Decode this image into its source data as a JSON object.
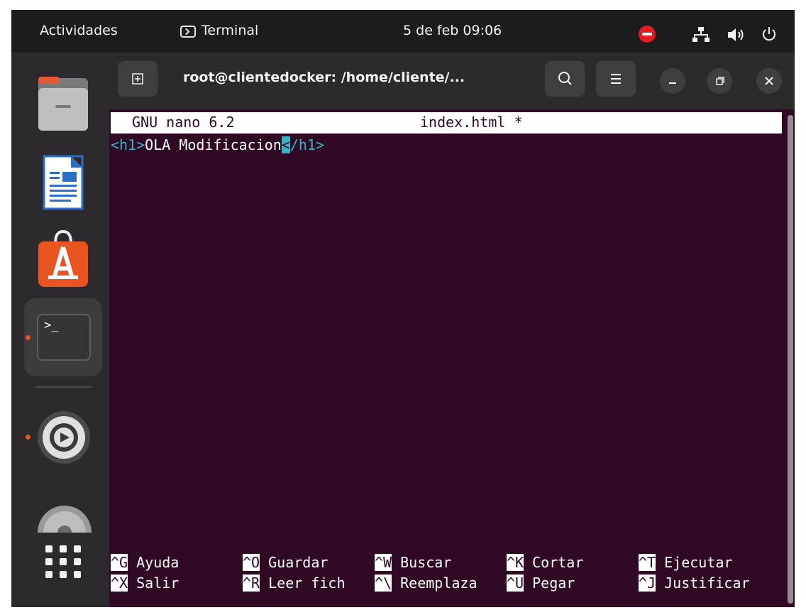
{
  "topbar": {
    "activities": "Actividades",
    "app_name": "Terminal",
    "clock": "5 de feb  09:06"
  },
  "window": {
    "title": "root@clientedocker: /home/cliente/..."
  },
  "nano": {
    "version": "GNU nano 6.2",
    "filename": "index.html *",
    "content": {
      "open_tag": "<h1>",
      "text": "OLA Modificacion",
      "cursor_char": "<",
      "close_rest": "/h1>"
    },
    "shortcuts": [
      {
        "key": "^G",
        "label": " Ayuda"
      },
      {
        "key": "^O",
        "label": " Guardar"
      },
      {
        "key": "^W",
        "label": " Buscar"
      },
      {
        "key": "^K",
        "label": " Cortar"
      },
      {
        "key": "^T",
        "label": " Ejecutar"
      },
      {
        "key": "^X",
        "label": " Salir"
      },
      {
        "key": "^R",
        "label": " Leer fich"
      },
      {
        "key": "^\\",
        "label": " Reemplaza"
      },
      {
        "key": "^U",
        "label": " Pegar"
      },
      {
        "key": "^J",
        "label": " Justificar"
      }
    ]
  },
  "dock": {
    "terminal_prompt": ">_"
  },
  "colors": {
    "terminal_bg": "#300a24",
    "accent_orange": "#e95420",
    "tag_cyan": "#34b4c7"
  }
}
